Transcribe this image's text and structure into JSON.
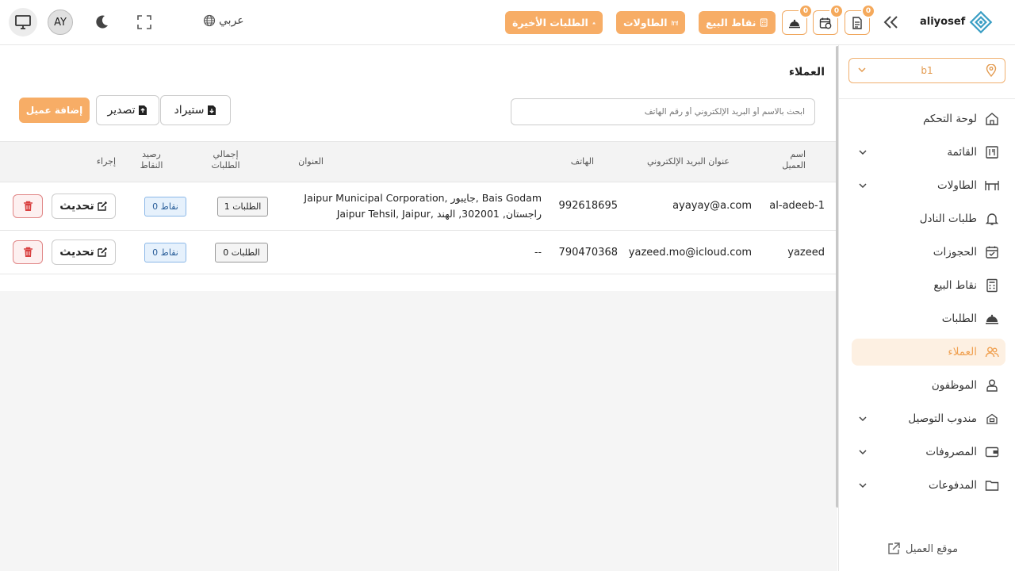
{
  "topbar": {
    "brand_name": "aliyosef",
    "badges": [
      "0",
      "0",
      "0"
    ],
    "buttons": {
      "pos": "نقاط البيع",
      "tables": "الطاولات",
      "recent_orders": "الطلبات الأخيرة"
    },
    "language": "عربي",
    "avatar_initials": "AY"
  },
  "sidebar": {
    "branch": "b1",
    "items": [
      {
        "label": "لوحة التحكم",
        "icon": "home-icon",
        "chevron": false
      },
      {
        "label": "القائمة",
        "icon": "menu-book-icon",
        "chevron": true
      },
      {
        "label": "الطاولات",
        "icon": "table-icon",
        "chevron": true
      },
      {
        "label": "طلبات النادل",
        "icon": "bell-icon",
        "chevron": false
      },
      {
        "label": "الحجوزات",
        "icon": "calendar-check-icon",
        "chevron": false
      },
      {
        "label": "نقاط البيع",
        "icon": "pos-icon",
        "chevron": false
      },
      {
        "label": "الطلبات",
        "icon": "cloche-icon",
        "chevron": false
      },
      {
        "label": "العملاء",
        "icon": "users-icon",
        "chevron": false,
        "active": true
      },
      {
        "label": "الموظفون",
        "icon": "staff-icon",
        "chevron": false
      },
      {
        "label": "مندوب التوصيل",
        "icon": "delivery-icon",
        "chevron": true
      },
      {
        "label": "المصروفات",
        "icon": "wallet-icon",
        "chevron": true
      },
      {
        "label": "المدفوعات",
        "icon": "folder-icon",
        "chevron": true
      }
    ],
    "footer": "موقع العميل"
  },
  "main": {
    "title": "العملاء",
    "search_placeholder": "ابحث بالاسم أو البريد الإلكتروني أو رقم الهاتف",
    "import_label": "ستيراد",
    "export_label": "تصدير",
    "add_label": "إضافة عميل",
    "columns": {
      "name": [
        "اسم",
        "العميل"
      ],
      "email": "عنوان البريد الإلكتروني",
      "phone": "الهاتف",
      "address": "العنوان",
      "orders": [
        "إجمالي",
        "الطلبات"
      ],
      "points": [
        "رصيد",
        "النقاط"
      ],
      "action": "إجراء"
    },
    "rows": [
      {
        "name": "al-adeeb-1",
        "email": "ayayay@a.com",
        "phone": "992618695",
        "address_line1": "Jaipur Municipal Corporation, جايبور, Bais Godam",
        "address_line2": "Jaipur Tehsil, Jaipur, راجستان, 302001, الهند",
        "orders": "1 الطلبات",
        "points": "0 نقاط",
        "update": "تحديث"
      },
      {
        "name": "yazeed",
        "email": "yazeed.mo@icloud.com",
        "phone": "790470368",
        "address_line1": "--",
        "address_line2": "",
        "orders": "0 الطلبات",
        "points": "0 نقاط",
        "update": "تحديث"
      }
    ]
  },
  "colors": {
    "accent": "#f7ad66",
    "active_bg": "#fdf0e2",
    "danger": "#d94040",
    "info": "#2b5f9a"
  }
}
